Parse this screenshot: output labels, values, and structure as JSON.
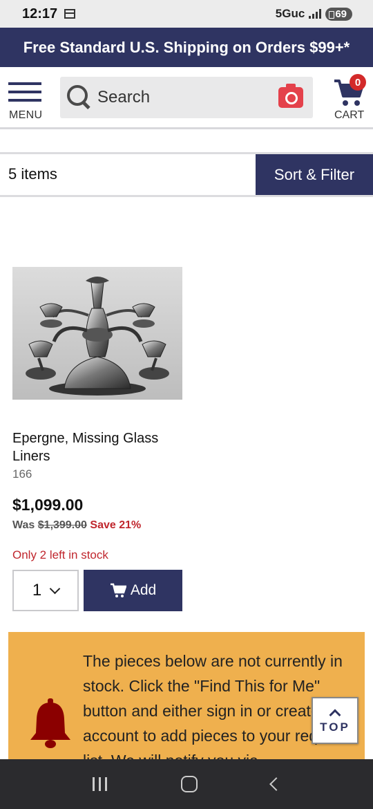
{
  "status_bar": {
    "time": "12:17",
    "network": "5Guc",
    "battery": "69"
  },
  "promo": {
    "text": "Free Standard U.S. Shipping on Orders $99+*"
  },
  "header": {
    "menu_label": "MENU",
    "search_placeholder": "Search",
    "cart_label": "CART",
    "cart_count": "0"
  },
  "results": {
    "count": "5 items",
    "sort_filter_label": "Sort & Filter"
  },
  "product": {
    "name": "Epergne, Missing Glass Liners",
    "sku": "166",
    "price": "$1,099.00",
    "was_label": "Was",
    "was_price": "$1,399.00",
    "save_text": "Save 21%",
    "stock_text": "Only 2 left in stock",
    "quantity": "1",
    "add_label": "Add"
  },
  "notice": {
    "text": "The pieces below are not currently in stock. Click the \"Find This for Me\" button and either sign in or create an account to add pieces to your request list. We will notify you via"
  },
  "top_button": {
    "label": "TOP"
  },
  "colors": {
    "navy": "#2f3462",
    "alert_red": "#c0262d",
    "notice_bg": "#efb04e"
  }
}
